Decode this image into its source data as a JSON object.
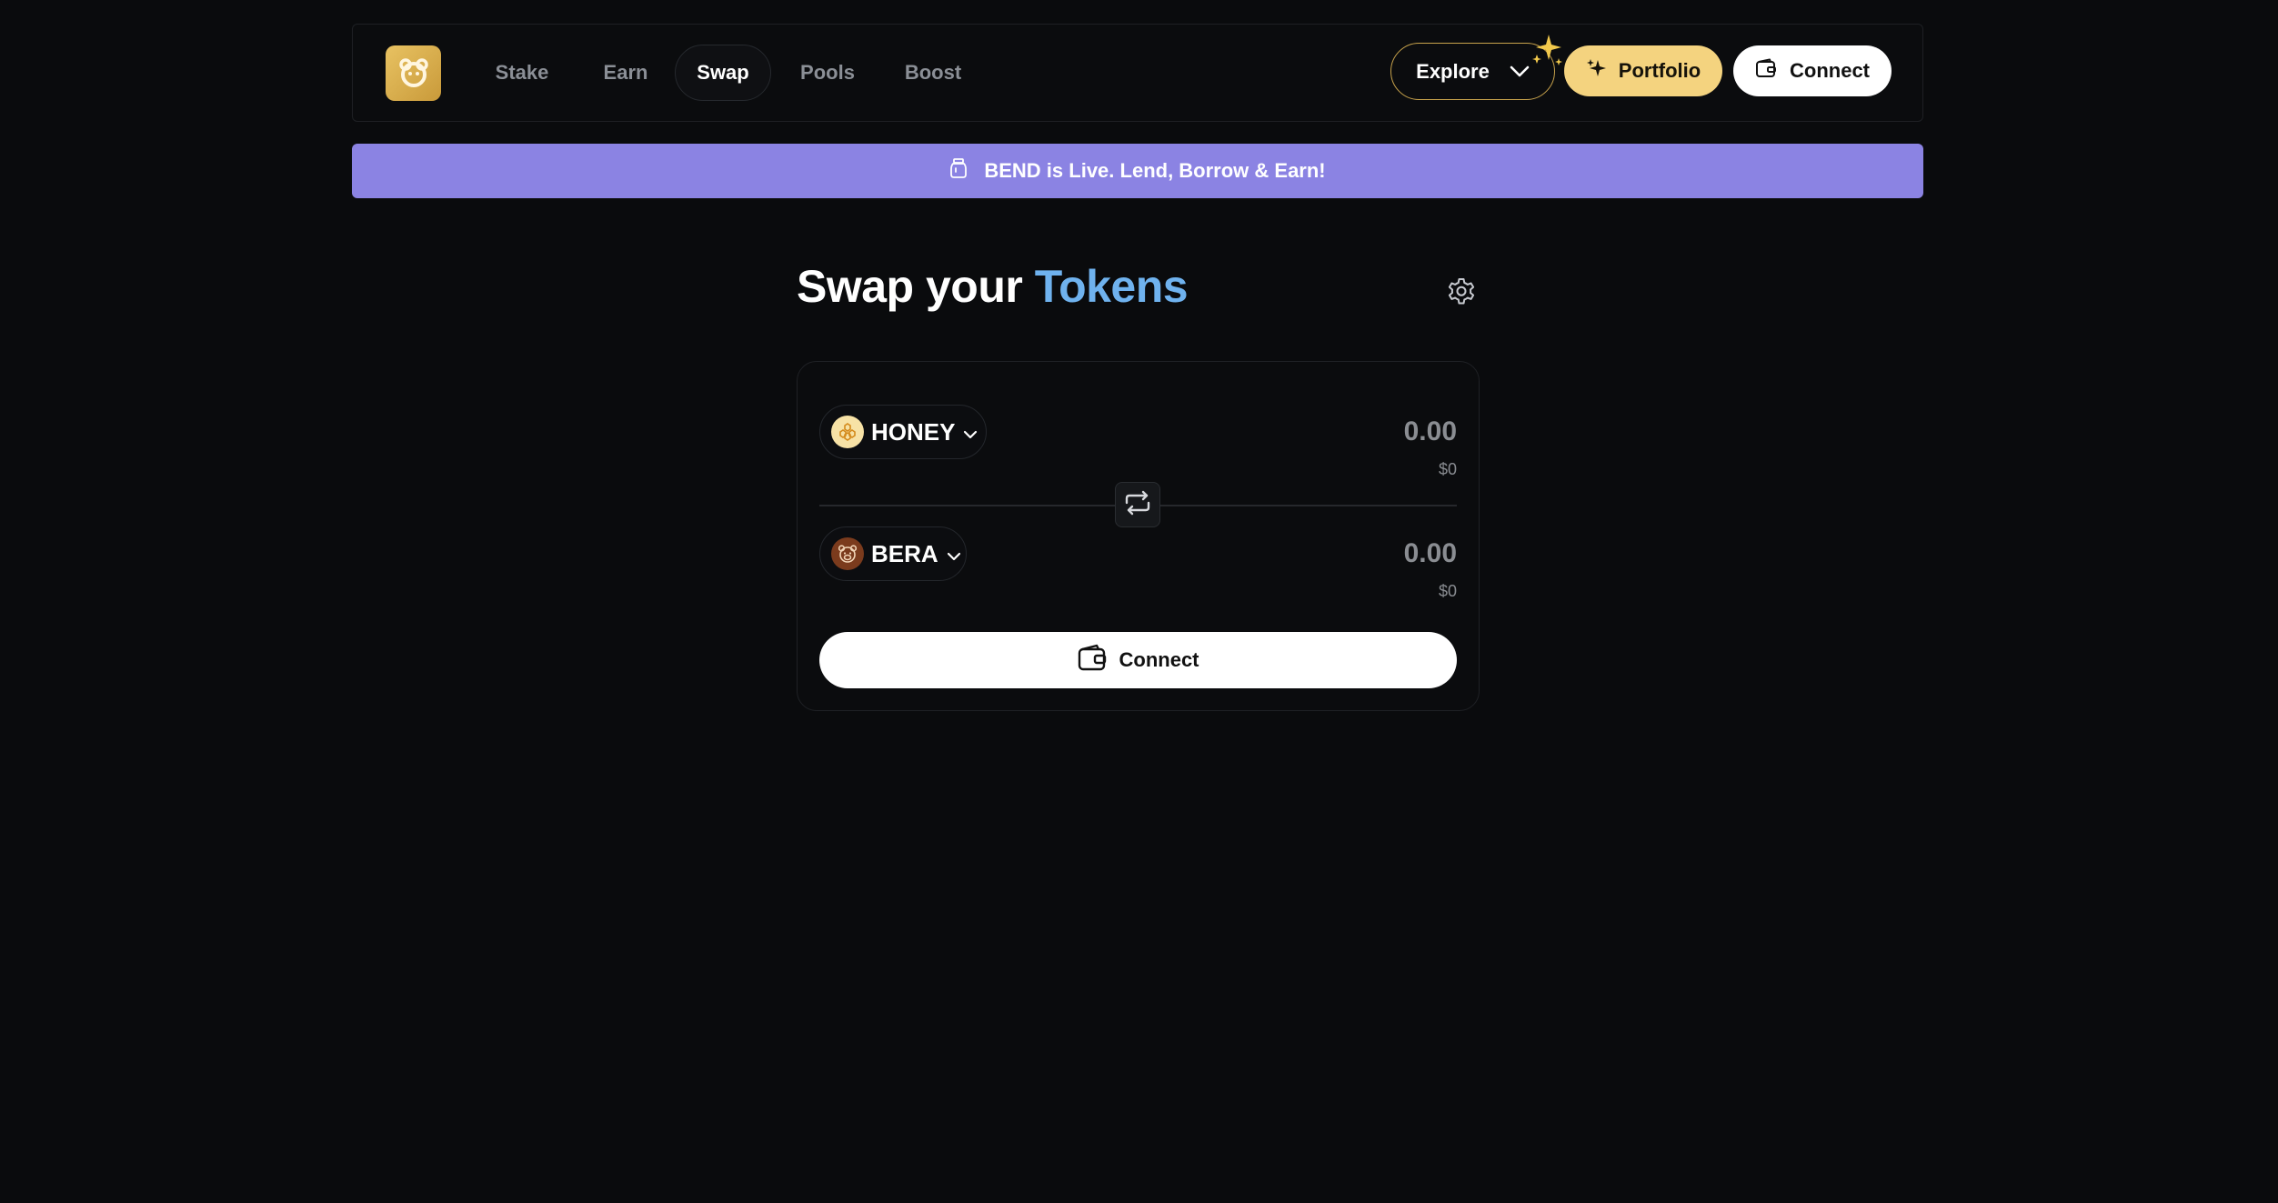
{
  "nav": {
    "logo_icon": "bear-logo-icon",
    "links": [
      {
        "label": "Stake",
        "active": false
      },
      {
        "label": "Earn",
        "active": false
      },
      {
        "label": "Swap",
        "active": true
      },
      {
        "label": "Pools",
        "active": false
      },
      {
        "label": "Boost",
        "active": false
      }
    ],
    "explore_label": "Explore",
    "portfolio_label": "Portfolio",
    "connect_label": "Connect"
  },
  "banner": {
    "text": "BEND is Live. Lend, Borrow & Earn!",
    "icon": "honey-jar-icon"
  },
  "title": {
    "prefix": "Swap your",
    "accent": "Tokens"
  },
  "swap": {
    "from": {
      "symbol": "HONEY",
      "amount": "0.00",
      "usd": "$0",
      "icon": "honey-token-icon"
    },
    "to": {
      "symbol": "BERA",
      "amount": "0.00",
      "usd": "$0",
      "icon": "bera-token-icon"
    },
    "connect_label": "Connect"
  },
  "colors": {
    "background": "#0a0b0d",
    "accent_blue": "#6fb2ee",
    "banner_purple": "#8b83e3",
    "gold": "#f4d37f"
  }
}
